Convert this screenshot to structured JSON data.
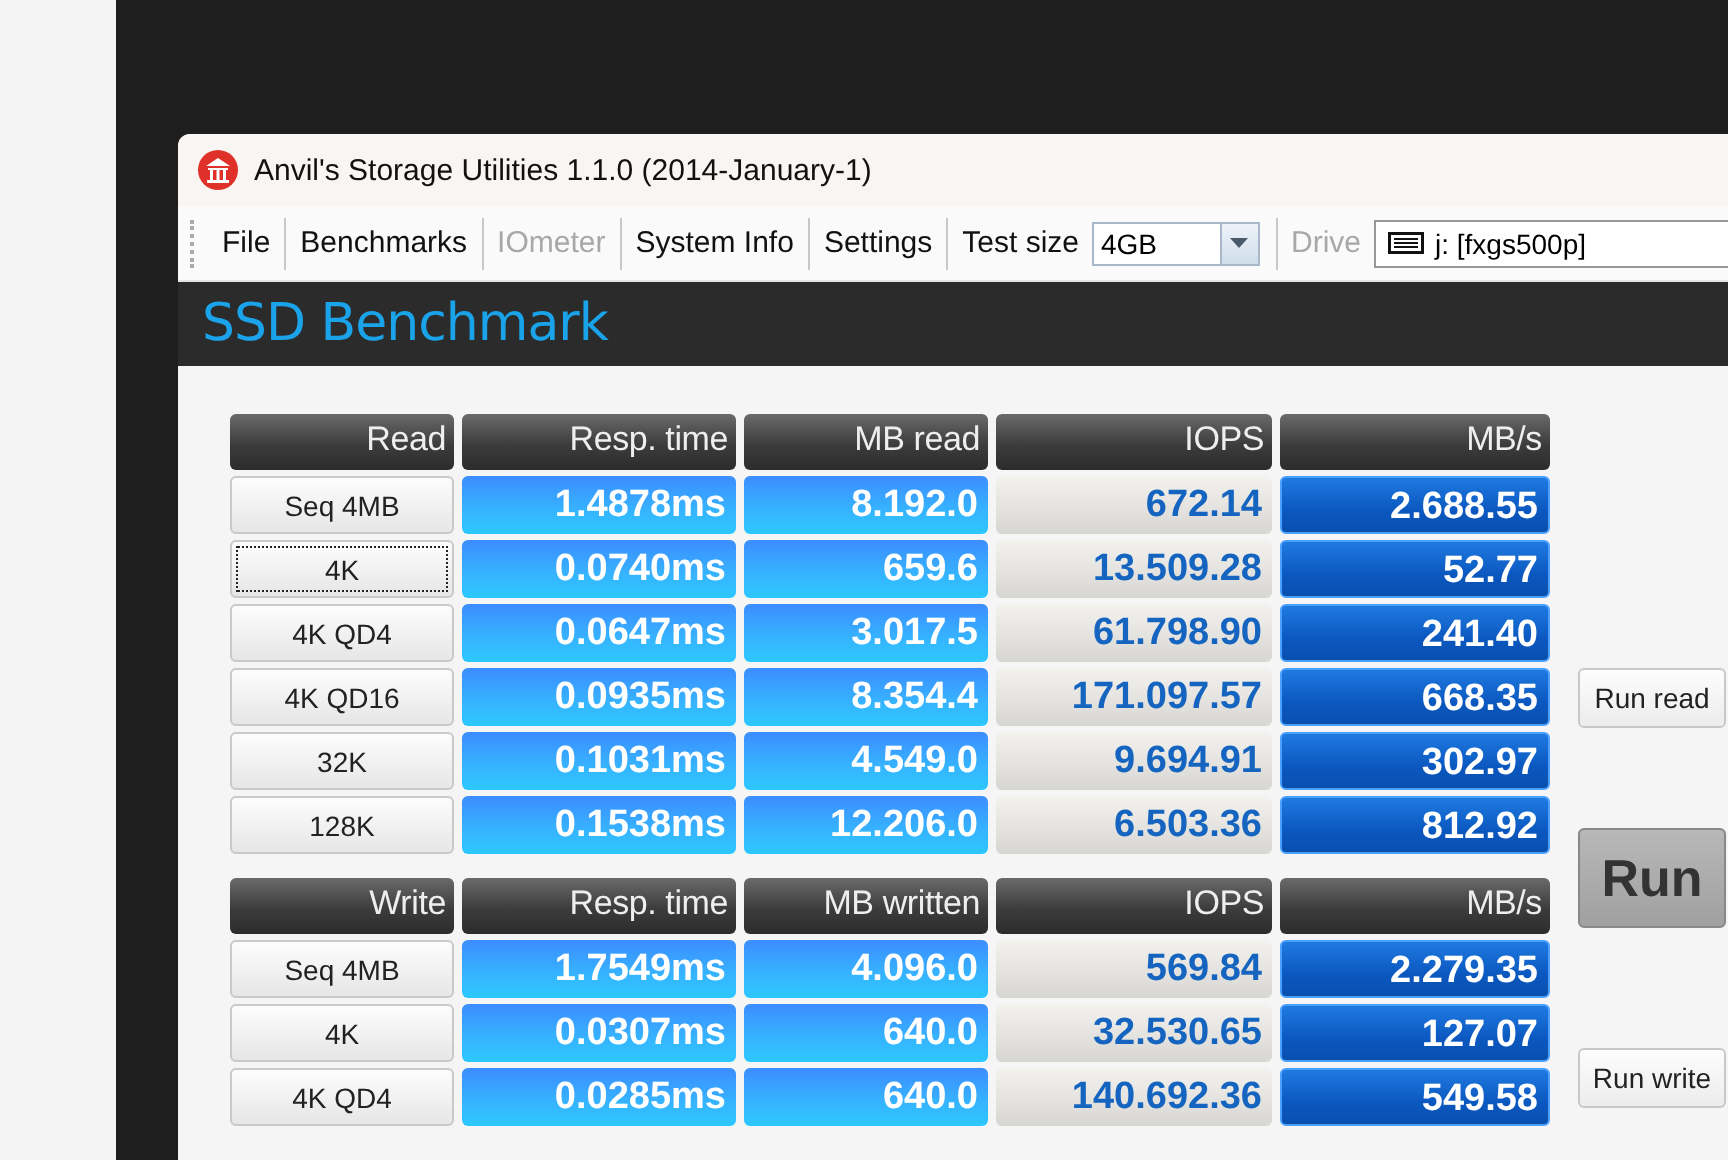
{
  "window": {
    "title": "Anvil's Storage Utilities 1.1.0 (2014-January-1)"
  },
  "menu": [
    {
      "label": "File",
      "disabled": false
    },
    {
      "label": "Benchmarks",
      "disabled": false
    },
    {
      "label": "IOmeter",
      "disabled": true
    },
    {
      "label": "System Info",
      "disabled": false
    },
    {
      "label": "Settings",
      "disabled": false
    }
  ],
  "test_size": {
    "label": "Test size",
    "value": "4GB"
  },
  "drive": {
    "label": "Drive",
    "disabled": true,
    "value": "j: [fxgs500p]"
  },
  "header": "SSD Benchmark",
  "sections": [
    {
      "columns": [
        "Read",
        "Resp. time",
        "MB read",
        "IOPS",
        "MB/s"
      ],
      "rows": [
        {
          "label": "Seq 4MB",
          "focused": false,
          "resp": "1.4878ms",
          "mb": "8.192.0",
          "iops": "672.14",
          "mbs": "2.688.55"
        },
        {
          "label": "4K",
          "focused": true,
          "resp": "0.0740ms",
          "mb": "659.6",
          "iops": "13.509.28",
          "mbs": "52.77"
        },
        {
          "label": "4K QD4",
          "focused": false,
          "resp": "0.0647ms",
          "mb": "3.017.5",
          "iops": "61.798.90",
          "mbs": "241.40"
        },
        {
          "label": "4K QD16",
          "focused": false,
          "resp": "0.0935ms",
          "mb": "8.354.4",
          "iops": "171.097.57",
          "mbs": "668.35"
        },
        {
          "label": "32K",
          "focused": false,
          "resp": "0.1031ms",
          "mb": "4.549.0",
          "iops": "9.694.91",
          "mbs": "302.97"
        },
        {
          "label": "128K",
          "focused": false,
          "resp": "0.1538ms",
          "mb": "12.206.0",
          "iops": "6.503.36",
          "mbs": "812.92"
        }
      ]
    },
    {
      "columns": [
        "Write",
        "Resp. time",
        "MB written",
        "IOPS",
        "MB/s"
      ],
      "rows": [
        {
          "label": "Seq 4MB",
          "focused": false,
          "resp": "1.7549ms",
          "mb": "4.096.0",
          "iops": "569.84",
          "mbs": "2.279.35"
        },
        {
          "label": "4K",
          "focused": false,
          "resp": "0.0307ms",
          "mb": "640.0",
          "iops": "32.530.65",
          "mbs": "127.07"
        },
        {
          "label": "4K QD4",
          "focused": false,
          "resp": "0.0285ms",
          "mb": "640.0",
          "iops": "140.692.36",
          "mbs": "549.58"
        }
      ]
    }
  ],
  "buttons": [
    {
      "label": "Run read",
      "kind": "small"
    },
    {
      "label": "Run",
      "kind": "large"
    },
    {
      "label": "Run write",
      "kind": "small"
    }
  ]
}
